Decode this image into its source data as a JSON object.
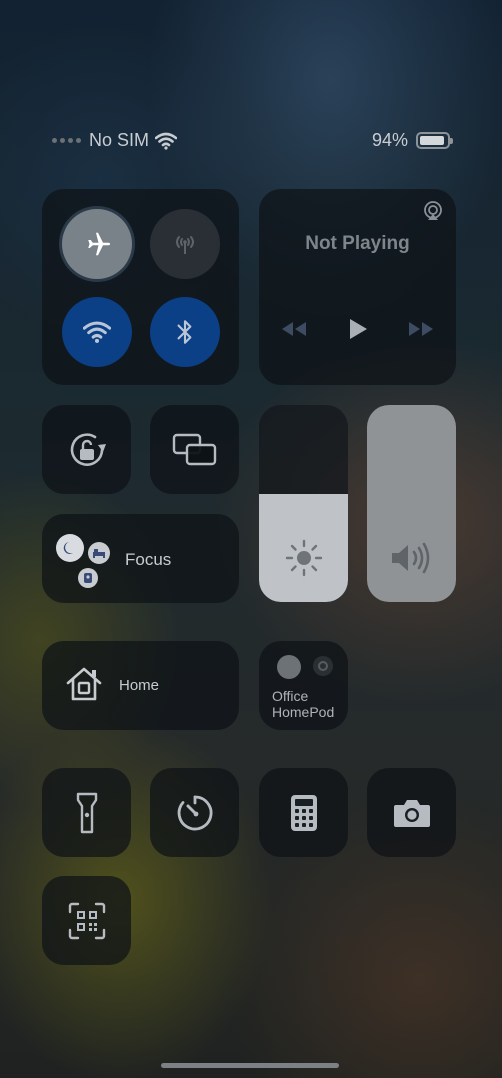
{
  "status_bar": {
    "carrier": "No SIM",
    "battery_percent": "94%",
    "battery_level": 0.94
  },
  "connectivity": {
    "airplane_mode": "on",
    "cellular": "off",
    "wifi": "on",
    "bluetooth": "on"
  },
  "media": {
    "title": "Not Playing"
  },
  "controls": {
    "focus_label": "Focus",
    "home_label": "Home",
    "homepod_line1": "Office",
    "homepod_line2": "HomePod"
  },
  "sliders": {
    "brightness_level": 0.55,
    "volume_level": 1.0
  },
  "colors": {
    "active_blue": "#0b3f86",
    "tile_dark": "#0e1216"
  }
}
